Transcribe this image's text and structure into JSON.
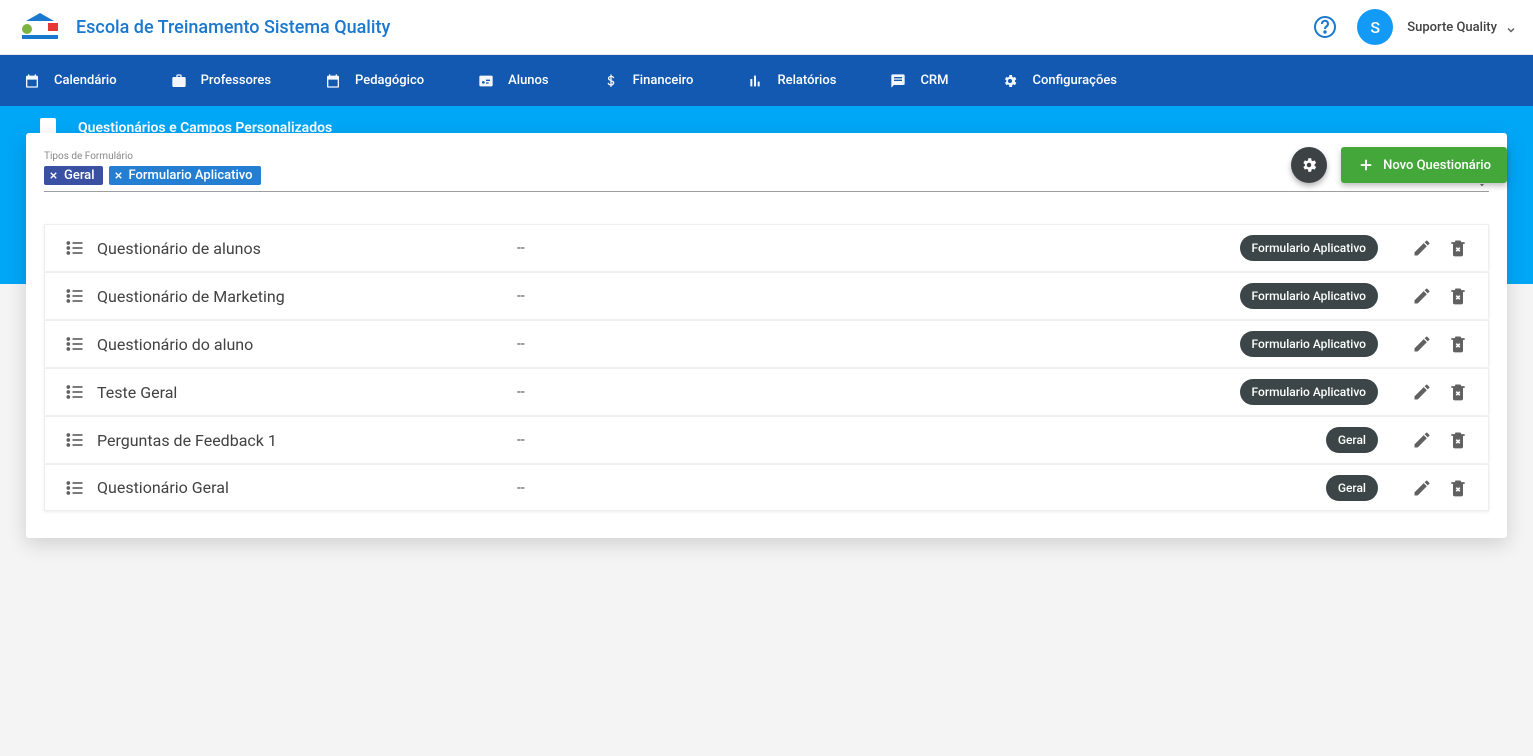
{
  "header": {
    "school_title": "Escola de Treinamento Sistema Quality",
    "avatar_initial": "S",
    "user_name": "Suporte Quality"
  },
  "nav": [
    {
      "label": "Calendário",
      "icon": "calendar"
    },
    {
      "label": "Professores",
      "icon": "briefcase"
    },
    {
      "label": "Pedagógico",
      "icon": "calendar"
    },
    {
      "label": "Alunos",
      "icon": "id-card"
    },
    {
      "label": "Financeiro",
      "icon": "dollar"
    },
    {
      "label": "Relatórios",
      "icon": "chart"
    },
    {
      "label": "CRM",
      "icon": "message"
    },
    {
      "label": "Configurações",
      "icon": "gear"
    }
  ],
  "subheader": {
    "title": "Questionários e Campos Personalizados"
  },
  "actions": {
    "new_label": "Novo Questionário"
  },
  "filter": {
    "label": "Tipos de Formulário",
    "chips": [
      "Geral",
      "Formulario Aplicativo"
    ]
  },
  "rows": [
    {
      "title": "Questionário de alunos",
      "mid": "--",
      "badge": "Formulario Aplicativo"
    },
    {
      "title": "Questionário de Marketing",
      "mid": "--",
      "badge": "Formulario Aplicativo"
    },
    {
      "title": "Questionário do aluno",
      "mid": "--",
      "badge": "Formulario Aplicativo"
    },
    {
      "title": "Teste Geral",
      "mid": "--",
      "badge": "Formulario Aplicativo"
    },
    {
      "title": "Perguntas de Feedback 1",
      "mid": "--",
      "badge": "Geral"
    },
    {
      "title": "Questionário Geral",
      "mid": "--",
      "badge": "Geral"
    }
  ]
}
